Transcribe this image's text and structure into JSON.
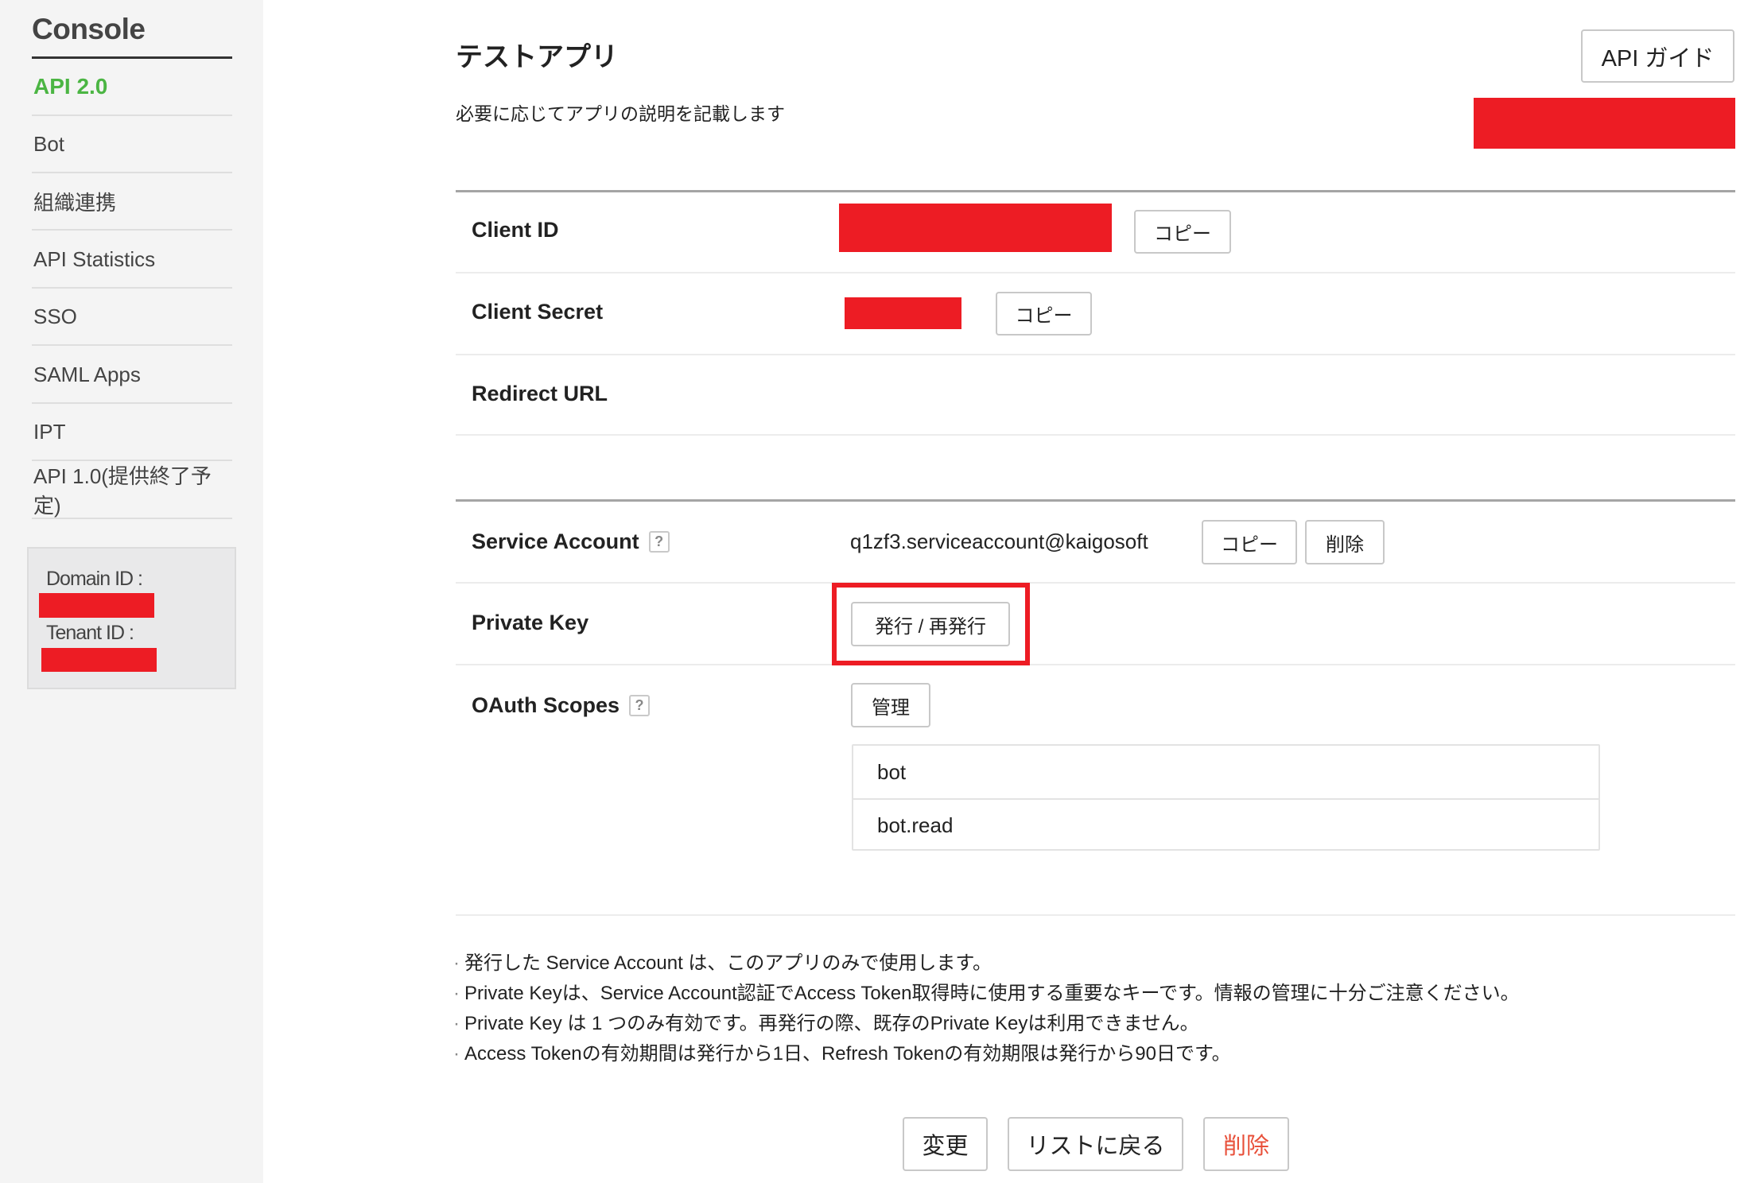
{
  "sidebar": {
    "title": "Console",
    "items": [
      {
        "label": "API 2.0",
        "active": true
      },
      {
        "label": "Bot"
      },
      {
        "label": "組織連携"
      },
      {
        "label": "API Statistics"
      },
      {
        "label": "SSO"
      },
      {
        "label": "SAML Apps"
      },
      {
        "label": "IPT"
      },
      {
        "label": "API 1.0(提供終了予定)"
      }
    ],
    "domain_id_label": "Domain ID :",
    "tenant_id_label": "Tenant ID :"
  },
  "header": {
    "title": "テストアプリ",
    "description": "必要に応じてアプリの説明を記載します",
    "api_guide_button": "API ガイド"
  },
  "fields": {
    "client_id": {
      "label": "Client ID",
      "copy": "コピー"
    },
    "client_secret": {
      "label": "Client Secret",
      "copy": "コピー"
    },
    "redirect_url": {
      "label": "Redirect URL"
    },
    "service_account": {
      "label": "Service Account",
      "help": "?",
      "value": "q1zf3.serviceaccount@kaigosoft",
      "copy": "コピー",
      "delete": "削除"
    },
    "private_key": {
      "label": "Private Key",
      "issue_button": "発行 / 再発行"
    },
    "oauth_scopes": {
      "label": "OAuth Scopes",
      "help": "?",
      "manage_button": "管理",
      "scopes": [
        "bot",
        "bot.read"
      ]
    }
  },
  "notes": [
    "発行した Service Account は、このアプリのみで使用します。",
    "Private Keyは、Service Account認証でAccess Token取得時に使用する重要なキーです。情報の管理に十分ご注意ください。",
    "Private Key は 1 つのみ有効です。再発行の際、既存のPrivate Keyは利用できません。",
    "Access Tokenの有効期間は発行から1日、Refresh Tokenの有効期限は発行から90日です。"
  ],
  "footer": {
    "change_button": "変更",
    "back_button": "リストに戻る",
    "delete_button": "削除"
  },
  "colors": {
    "accent_green": "#4bb543",
    "redaction_red": "#ed1c24",
    "danger_text": "#e8503a"
  }
}
